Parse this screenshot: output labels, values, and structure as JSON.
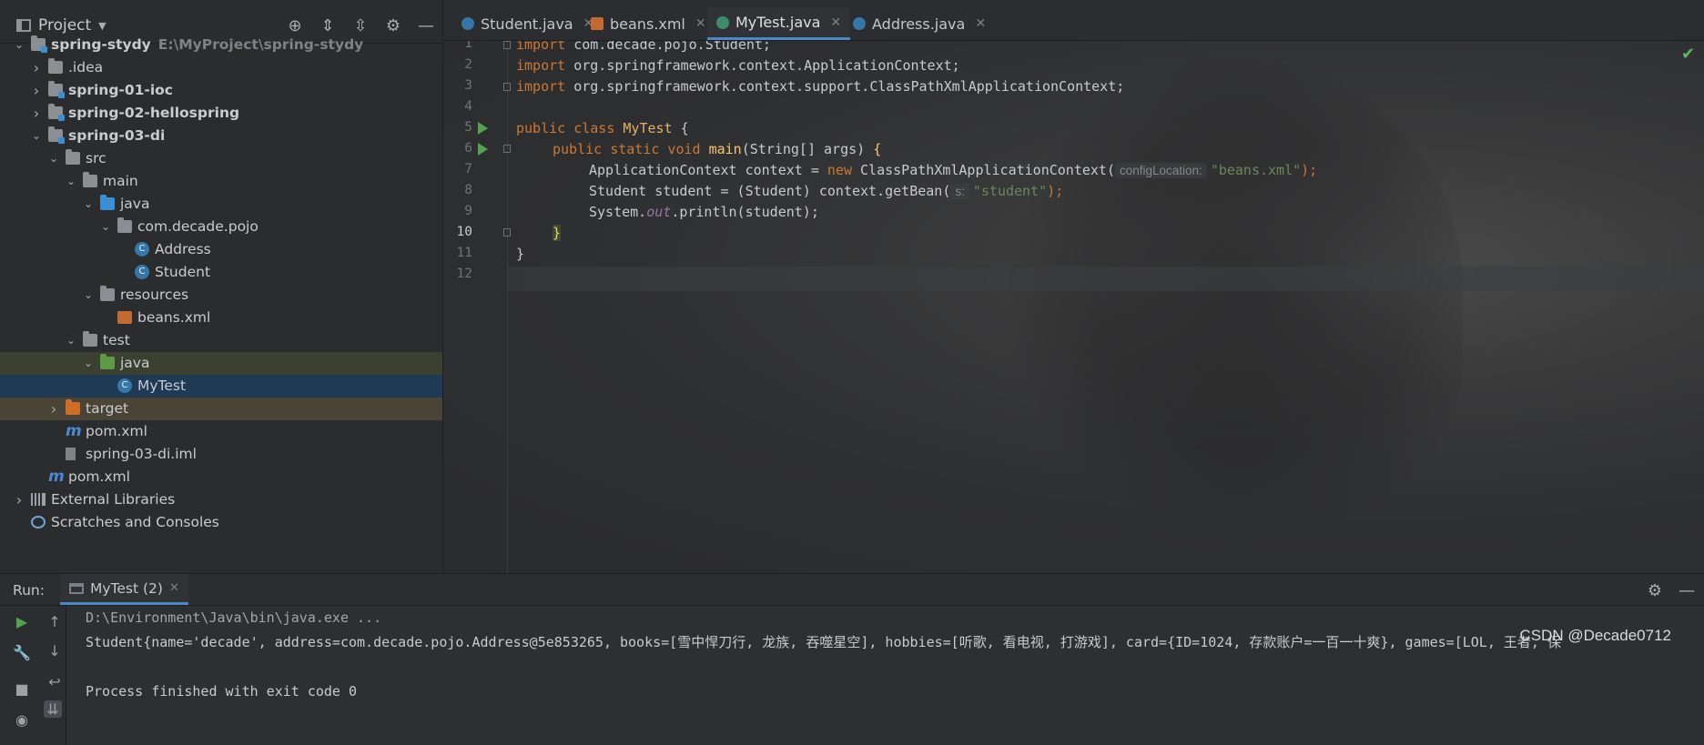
{
  "project_panel": {
    "title": "Project",
    "header_icons": [
      "locate-icon",
      "expand-all-icon",
      "collapse-all-icon",
      "gear-icon",
      "minimize-icon"
    ],
    "tree": [
      {
        "label": "spring-stydy",
        "path": "E:\\MyProject\\spring-stydy",
        "bold": true,
        "depth": 0,
        "chevron": "down",
        "icon": "module-folder-icon"
      },
      {
        "label": ".idea",
        "depth": 1,
        "chevron": "right",
        "icon": "folder-icon"
      },
      {
        "label": "spring-01-ioc",
        "bold": true,
        "depth": 1,
        "chevron": "right",
        "icon": "module-folder-icon"
      },
      {
        "label": "spring-02-hellospring",
        "bold": true,
        "depth": 1,
        "chevron": "right",
        "icon": "module-folder-icon"
      },
      {
        "label": "spring-03-di",
        "bold": true,
        "depth": 1,
        "chevron": "down",
        "icon": "module-folder-icon"
      },
      {
        "label": "src",
        "depth": 2,
        "chevron": "down",
        "icon": "folder-icon"
      },
      {
        "label": "main",
        "depth": 3,
        "chevron": "down",
        "icon": "folder-icon"
      },
      {
        "label": "java",
        "depth": 4,
        "chevron": "down",
        "icon": "source-folder-icon"
      },
      {
        "label": "com.decade.pojo",
        "depth": 5,
        "chevron": "down",
        "icon": "package-icon"
      },
      {
        "label": "Address",
        "depth": 6,
        "icon": "class-icon"
      },
      {
        "label": "Student",
        "depth": 6,
        "icon": "class-icon"
      },
      {
        "label": "resources",
        "depth": 4,
        "chevron": "down",
        "icon": "resources-folder-icon"
      },
      {
        "label": "beans.xml",
        "depth": 5,
        "icon": "xml-file-icon"
      },
      {
        "label": "test",
        "depth": 3,
        "chevron": "down",
        "icon": "folder-icon"
      },
      {
        "label": "java",
        "depth": 4,
        "chevron": "down",
        "icon": "test-folder-icon",
        "highlight": "light"
      },
      {
        "label": "MyTest",
        "depth": 5,
        "icon": "test-class-icon",
        "highlight": "dark"
      },
      {
        "label": "target",
        "depth": 2,
        "chevron": "right",
        "icon": "excluded-folder-icon",
        "highlight": "orange"
      },
      {
        "label": "pom.xml",
        "depth": 2,
        "icon": "maven-icon"
      },
      {
        "label": "spring-03-di.iml",
        "depth": 2,
        "icon": "iml-file-icon"
      },
      {
        "label": "pom.xml",
        "depth": 1,
        "icon": "maven-icon"
      },
      {
        "label": "External Libraries",
        "depth": 0,
        "chevron": "right",
        "icon": "library-icon"
      },
      {
        "label": "Scratches and Consoles",
        "depth": 0,
        "icon": "scratches-icon"
      }
    ]
  },
  "tabs": [
    {
      "label": "Student.java",
      "icon": "class"
    },
    {
      "label": "beans.xml",
      "icon": "xml"
    },
    {
      "label": "MyTest.java",
      "icon": "test",
      "active": true
    },
    {
      "label": "Address.java",
      "icon": "class"
    }
  ],
  "editor": {
    "line_numbers": [
      "1",
      "2",
      "3",
      "4",
      "5",
      "6",
      "7",
      "8",
      "9",
      "10",
      "11",
      "12"
    ],
    "current_line": "10",
    "code": {
      "l1_kw": "import",
      "l1_rest": " com.decade.pojo.Student;",
      "l2_kw": "import",
      "l2_rest": " org.springframework.context.ApplicationContext;",
      "l3_kw": "import",
      "l3_rest": " org.springframework.context.support.ClassPathXmlApplicationContext;",
      "l5_kw": "public class",
      "l5_cls": " MyTest",
      "l5_rest": " {",
      "l6_kw": "public static void",
      "l6_fn": " main",
      "l6_rest": "(String[] args) ",
      "l6_brace": "{",
      "l7_a": "ApplicationContext context = ",
      "l7_kw": "new",
      "l7_b": " ClassPathXmlApplicationContext(",
      "l7_hint": "configLocation:",
      "l7_str": "\"beans.xml\"",
      "l7_end": ");",
      "l8_a": "Student student = (Student) context.getBean(",
      "l8_hint": "s:",
      "l8_str": "\"student\"",
      "l8_end": ");",
      "l9_a": "System.",
      "l9_static": "out",
      "l9_b": ".println(student);",
      "l10": "}",
      "l11": "}"
    },
    "status_icon": "check-icon"
  },
  "run": {
    "label": "Run:",
    "tab_label": "MyTest (2)",
    "console": [
      "D:\\Environment\\Java\\bin\\java.exe ...",
      "Student{name='decade', address=com.decade.pojo.Address@5e853265, books=[雪中悍刀行, 龙族, 吞噬星空], hobbies=[听歌, 看电视, 打游戏], card={ID=1024, 存款账户=一百一十爽}, games=[LOL, 王者, 保",
      "",
      "Process finished with exit code 0"
    ]
  },
  "watermark": "CSDN @Decade0712"
}
